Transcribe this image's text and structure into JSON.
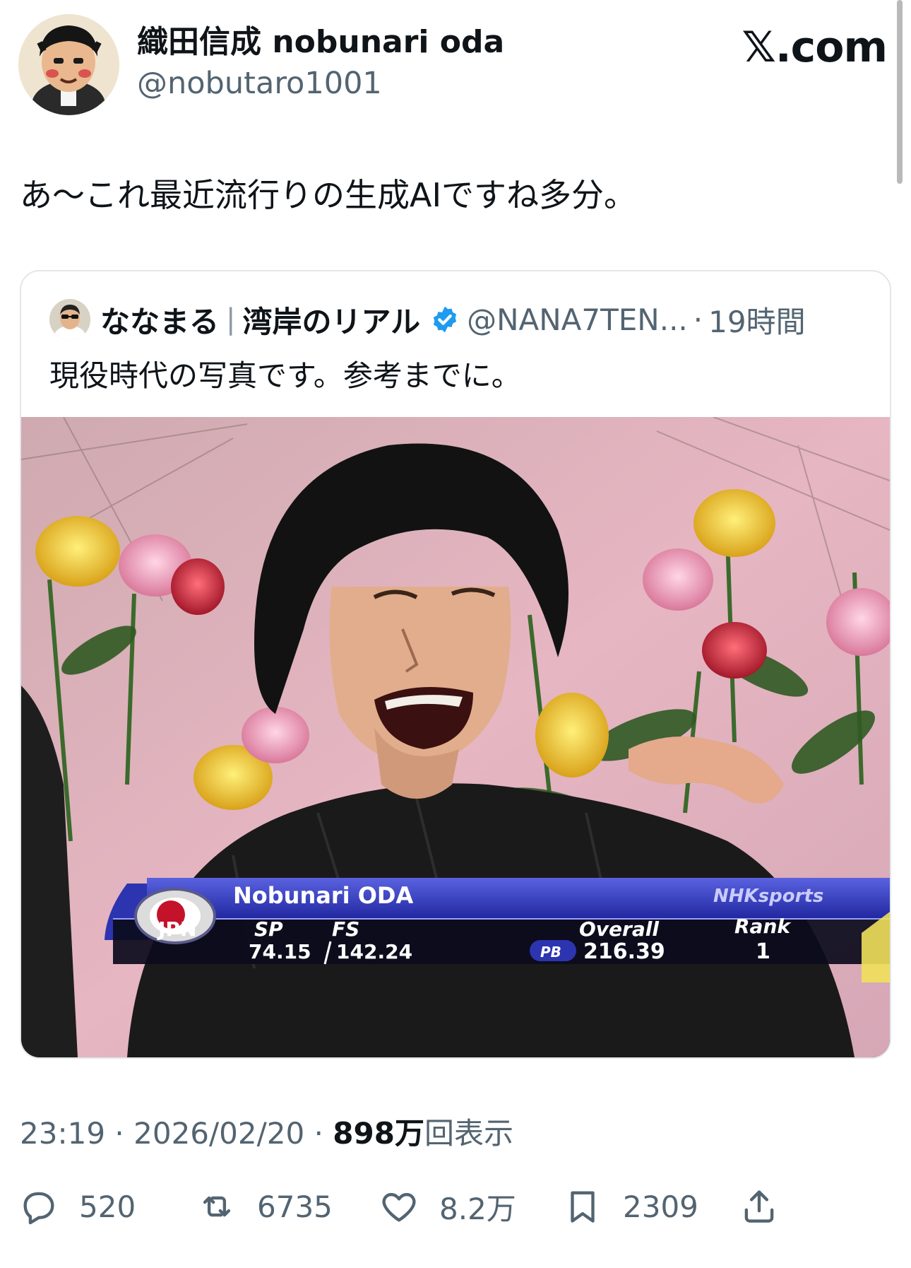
{
  "author": {
    "display_name": "織田信成 nobunari oda",
    "handle": "@nobutaro1001"
  },
  "brand": "𝕏.com",
  "tweet_text": "あ〜これ最近流行りの生成AIですね多分。",
  "quote": {
    "display_name": "ななまる",
    "separator": "|",
    "display_name_suffix": "湾岸のリアル",
    "handle": "@NANA7TEN...",
    "dot": "·",
    "time": "19時間",
    "text": "現役時代の写真です。参考までに。",
    "overlay": {
      "name": "Nobunari ODA",
      "country": "JPN",
      "sp_label": "SP",
      "fs_label": "FS",
      "overall_label": "Overall",
      "rank_label": "Rank",
      "network": "NHKsports",
      "sp_score": "74.15",
      "fs_score": "142.24",
      "pb_badge": "PB",
      "overall_score": "216.39",
      "rank": "1"
    }
  },
  "meta": {
    "time": "23:19",
    "dot1": "·",
    "date": "2026/02/20",
    "dot2": "·",
    "views": "898万",
    "views_label": "回表示"
  },
  "actions": {
    "replies": "520",
    "reposts": "6735",
    "likes": "8.2万",
    "bookmarks": "2309"
  },
  "colors": {
    "verified": "#1d9bf0",
    "text": "#0f1419",
    "secondary": "#536471",
    "overlay_blue": "#2c34b0"
  }
}
